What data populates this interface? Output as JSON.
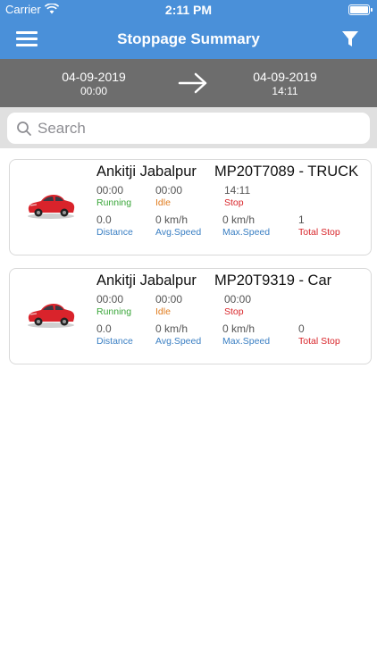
{
  "status_bar": {
    "carrier": "Carrier",
    "time": "2:11 PM"
  },
  "nav": {
    "title": "Stoppage Summary",
    "menu_icon": "hamburger-menu-icon",
    "filter_icon": "filter-icon"
  },
  "date_range": {
    "from_date": "04-09-2019",
    "from_time": "00:00",
    "to_date": "04-09-2019",
    "to_time": "14:11"
  },
  "search": {
    "placeholder": "Search"
  },
  "colors": {
    "primary": "#4a90d9",
    "date_bar": "#6d6d6d",
    "running": "#3aa63a",
    "idle": "#e07b1e",
    "stop": "#d9262b",
    "metric": "#3a7fc3"
  },
  "cards": [
    {
      "name": "Ankitji Jabalpur",
      "vehicle": "MP20T7089 - TRUCK",
      "running": "00:00",
      "running_label": "Running",
      "idle": "00:00",
      "idle_label": "Idle",
      "stop": "14:11",
      "stop_label": "Stop",
      "distance": "0.0",
      "distance_label": "Distance",
      "avg_speed": "0 km/h",
      "avg_speed_label": "Avg.Speed",
      "max_speed": "0 km/h",
      "max_speed_label": "Max.Speed",
      "total_stop": "1",
      "total_stop_label": "Total Stop"
    },
    {
      "name": "Ankitji Jabalpur",
      "vehicle": "MP20T9319 - Car",
      "running": "00:00",
      "running_label": "Running",
      "idle": "00:00",
      "idle_label": "Idle",
      "stop": "00:00",
      "stop_label": "Stop",
      "distance": "0.0",
      "distance_label": "Distance",
      "avg_speed": "0 km/h",
      "avg_speed_label": "Avg.Speed",
      "max_speed": "0 km/h",
      "max_speed_label": "Max.Speed",
      "total_stop": "0",
      "total_stop_label": "Total Stop"
    }
  ]
}
